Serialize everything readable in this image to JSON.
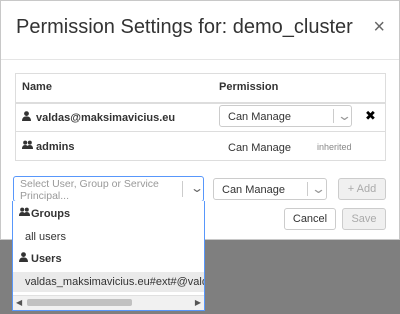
{
  "modal": {
    "title": "Permission Settings for: demo_cluster",
    "close_glyph": "×"
  },
  "table": {
    "headers": {
      "name": "Name",
      "permission": "Permission"
    },
    "rows": [
      {
        "icon": "user-icon",
        "name": "valdas@maksimavicius.eu",
        "permission": "Can Manage",
        "remove_glyph": "✖"
      },
      {
        "icon": "users-icon",
        "name": "admins",
        "permission": "Can Manage",
        "note": "inherited"
      }
    ]
  },
  "add_row": {
    "principal_placeholder": "Select User, Group or Service Principal...",
    "permission_value": "Can Manage",
    "add_label": "+ Add"
  },
  "footer": {
    "cancel_label": "Cancel",
    "save_label": "Save"
  },
  "dropdown": {
    "groups_header": "Groups",
    "groups": [
      "all users"
    ],
    "users_header": "Users",
    "users": [
      "valdas_maksimavicius.eu#ext#@valdas"
    ]
  },
  "colors": {
    "focus_border": "#5897fb",
    "backdrop": "#7f7f7f",
    "highlight": "#eaeaea"
  }
}
